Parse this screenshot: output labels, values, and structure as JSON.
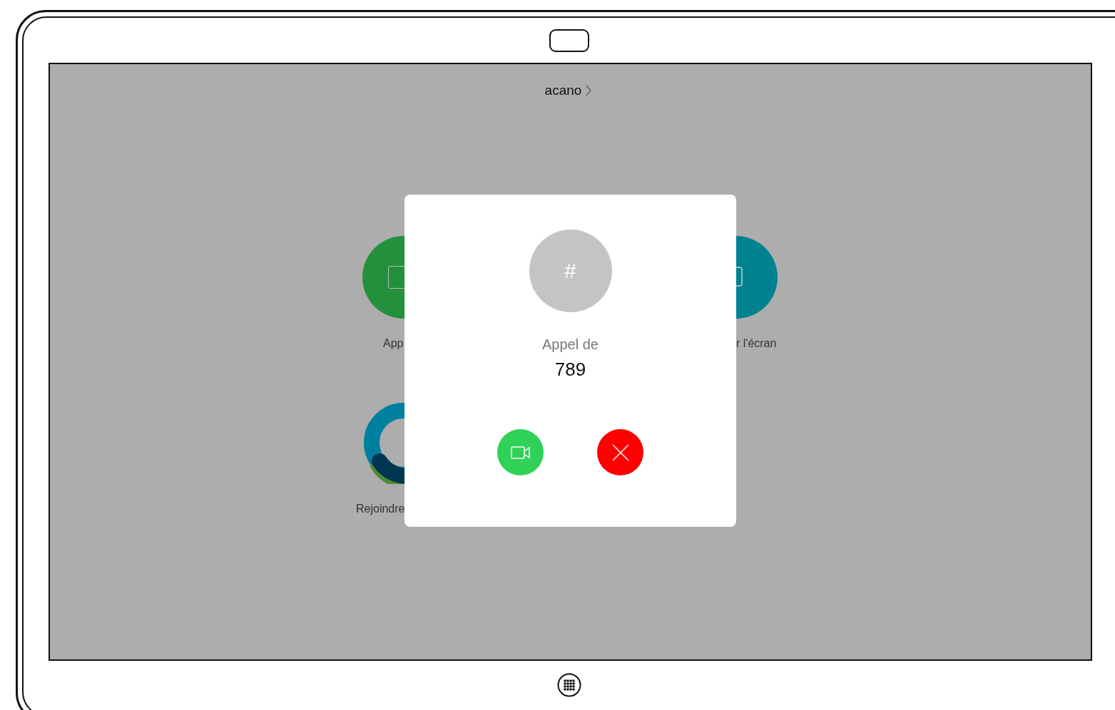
{
  "header": {
    "title": "acano"
  },
  "home_tiles": [
    {
      "kind": "call",
      "label": "App"
    },
    {
      "kind": "share",
      "label": "r l'écran"
    },
    {
      "kind": "join",
      "label": "Rejoindre"
    }
  ],
  "incoming_call": {
    "avatar": "#",
    "caption": "Appel de",
    "caller": "789",
    "actions": [
      {
        "kind": "accept"
      },
      {
        "kind": "decline"
      }
    ]
  }
}
